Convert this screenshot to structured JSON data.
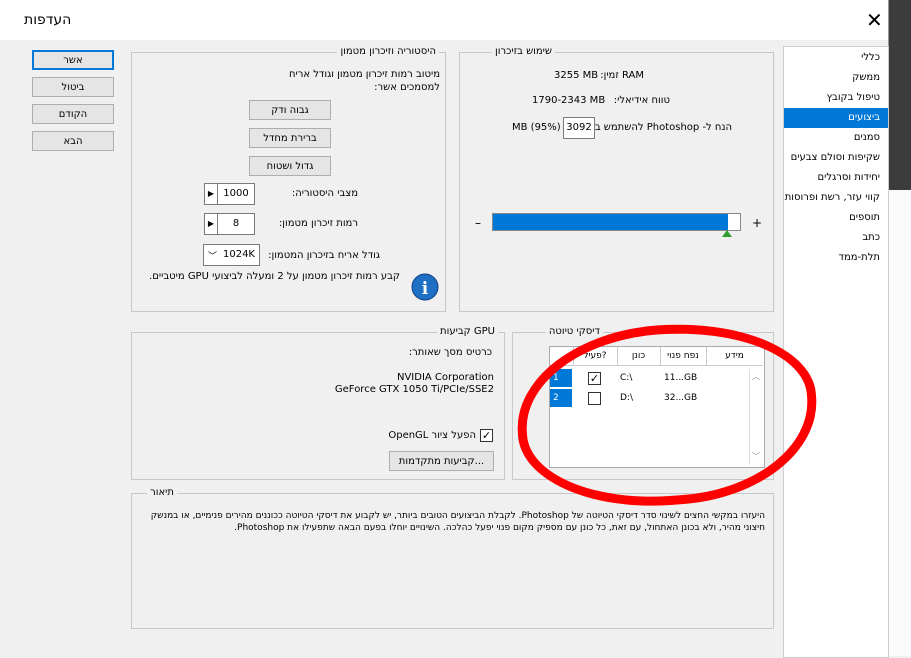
{
  "window": {
    "title": "העדפות",
    "close": "✕"
  },
  "buttons": {
    "ok": "אשר",
    "cancel": "ביטול",
    "prev": "הקודם",
    "next": "הבא"
  },
  "sidebar": {
    "items": [
      {
        "label": "כללי"
      },
      {
        "label": "ממשק"
      },
      {
        "label": "טיפול בקובץ"
      },
      {
        "label": "ביצועים"
      },
      {
        "label": "סמנים"
      },
      {
        "label": "שקיפות וסולם צבעים"
      },
      {
        "label": "יחידות וסרגלים"
      },
      {
        "label": "קווי עזר, רשת ופרוסות"
      },
      {
        "label": "תוספים"
      },
      {
        "label": "כתב"
      },
      {
        "label": "תלת-ממד"
      }
    ],
    "selected": "ביצועים"
  },
  "history": {
    "legend": "היסטוריה וזיכרון מטמון",
    "desc": "מיטוב רמות זיכרון מטמון וגודל אריח למסמכים אשר:",
    "btn_tall": "גבוה ודק",
    "btn_default": "ברירת מחדל",
    "btn_big": "גדול ושטוח",
    "states_label": "מצבי היסטוריה:",
    "states_value": "1000",
    "levels_label": "רמות זיכרון מטמון:",
    "levels_value": "8",
    "tile_label": "גודל אריח בזיכרון המטמון:",
    "tile_value": "1024K",
    "note": "קבע רמות זיכרון מטמון על 2 ומעלה לביצועי GPU מיטביים."
  },
  "memory": {
    "legend": "שימוש בזיכרון",
    "ram_label": "RAM זמין:",
    "ram_value": "3255 MB",
    "ideal_label": "טווח אידיאלי:",
    "ideal_value": "1790-2343 MB",
    "let_label": "הנח ל- Photoshop להשתמש ב:",
    "let_value": "3092",
    "let_unit": "MB (95%)",
    "minus": "–",
    "plus": "+",
    "usage_fraction": 0.95
  },
  "gpu": {
    "legend": "קביעות GPU",
    "detected_label": "כרטיס מסך שאותר:",
    "vendor": "NVIDIA Corporation",
    "model": "GeForce GTX 1050 Ti/PCIe/SSE2",
    "opengl_label": "הפעל ציור OpenGL",
    "opengl_checked": "✓",
    "advanced_btn": "קביעות מתקדמות..."
  },
  "scratch": {
    "legend": "דיסקי טיוטה",
    "headers": {
      "active": "פעיל?",
      "drive": "כונן",
      "free": "נפח פנוי",
      "info": "מידע"
    },
    "rows": [
      {
        "num": "1",
        "checked": "✓",
        "drive": "C:\\",
        "free": "11...GB",
        "info": ""
      },
      {
        "num": "2",
        "checked": "",
        "drive": "D:\\",
        "free": "32...GB",
        "info": ""
      }
    ]
  },
  "description": {
    "legend": "תיאור",
    "text": "היעזרו במקשי החצים לשינוי סדר דיסקי הטיוטה של Photoshop. לקבלת הביצועים הטובים ביותר, יש לקבוע את דיסקי הטיוטה ככוננים מהירים פנימיים, או במנשק חיצוני מהיר, ולא בכונן האתחול, עם זאת, כל כונן עם מספיק מקום פנוי יפעל כהלכה. השינויים יוחלו בפעם הבאה שתפעילו את Photoshop."
  },
  "colors": {
    "accent": "#0078d7",
    "annotation": "#ff0000"
  }
}
